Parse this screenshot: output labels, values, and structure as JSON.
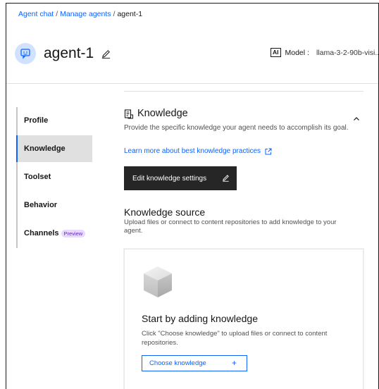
{
  "breadcrumb": {
    "items": [
      "Agent chat",
      "Manage agents",
      "agent-1"
    ],
    "separator": "/"
  },
  "agent": {
    "name": "agent-1",
    "avatar_icon": "chat-bot-icon",
    "edit_icon": "pencil-icon"
  },
  "model": {
    "badge": "AI",
    "label": "Model :",
    "value": "llama-3-2-90b-visi..."
  },
  "sidebar": {
    "items": [
      {
        "label": "Profile",
        "active": false
      },
      {
        "label": "Knowledge",
        "active": true
      },
      {
        "label": "Toolset",
        "active": false
      },
      {
        "label": "Behavior",
        "active": false
      },
      {
        "label": "Channels",
        "active": false,
        "tag": "Preview"
      }
    ]
  },
  "knowledge": {
    "title": "Knowledge",
    "description": "Provide the specific knowledge your agent needs to accomplish its goal.",
    "learn_link": "Learn more about best knowledge practices",
    "edit_button": "Edit knowledge settings"
  },
  "source": {
    "title": "Knowledge source",
    "description": "Upload files or connect to content repositories to add knowledge to your agent."
  },
  "empty_state": {
    "title": "Start by adding knowledge",
    "description": "Click \"Choose knowledge\" to upload files or connect to content repositories.",
    "button": "Choose knowledge",
    "button_icon": "+"
  },
  "colors": {
    "link": "#0f62fe",
    "dark_button": "#262626",
    "avatar_bg": "#d0e2ff",
    "preview_tag_bg": "#e8daff",
    "preview_tag_text": "#6929c4"
  }
}
